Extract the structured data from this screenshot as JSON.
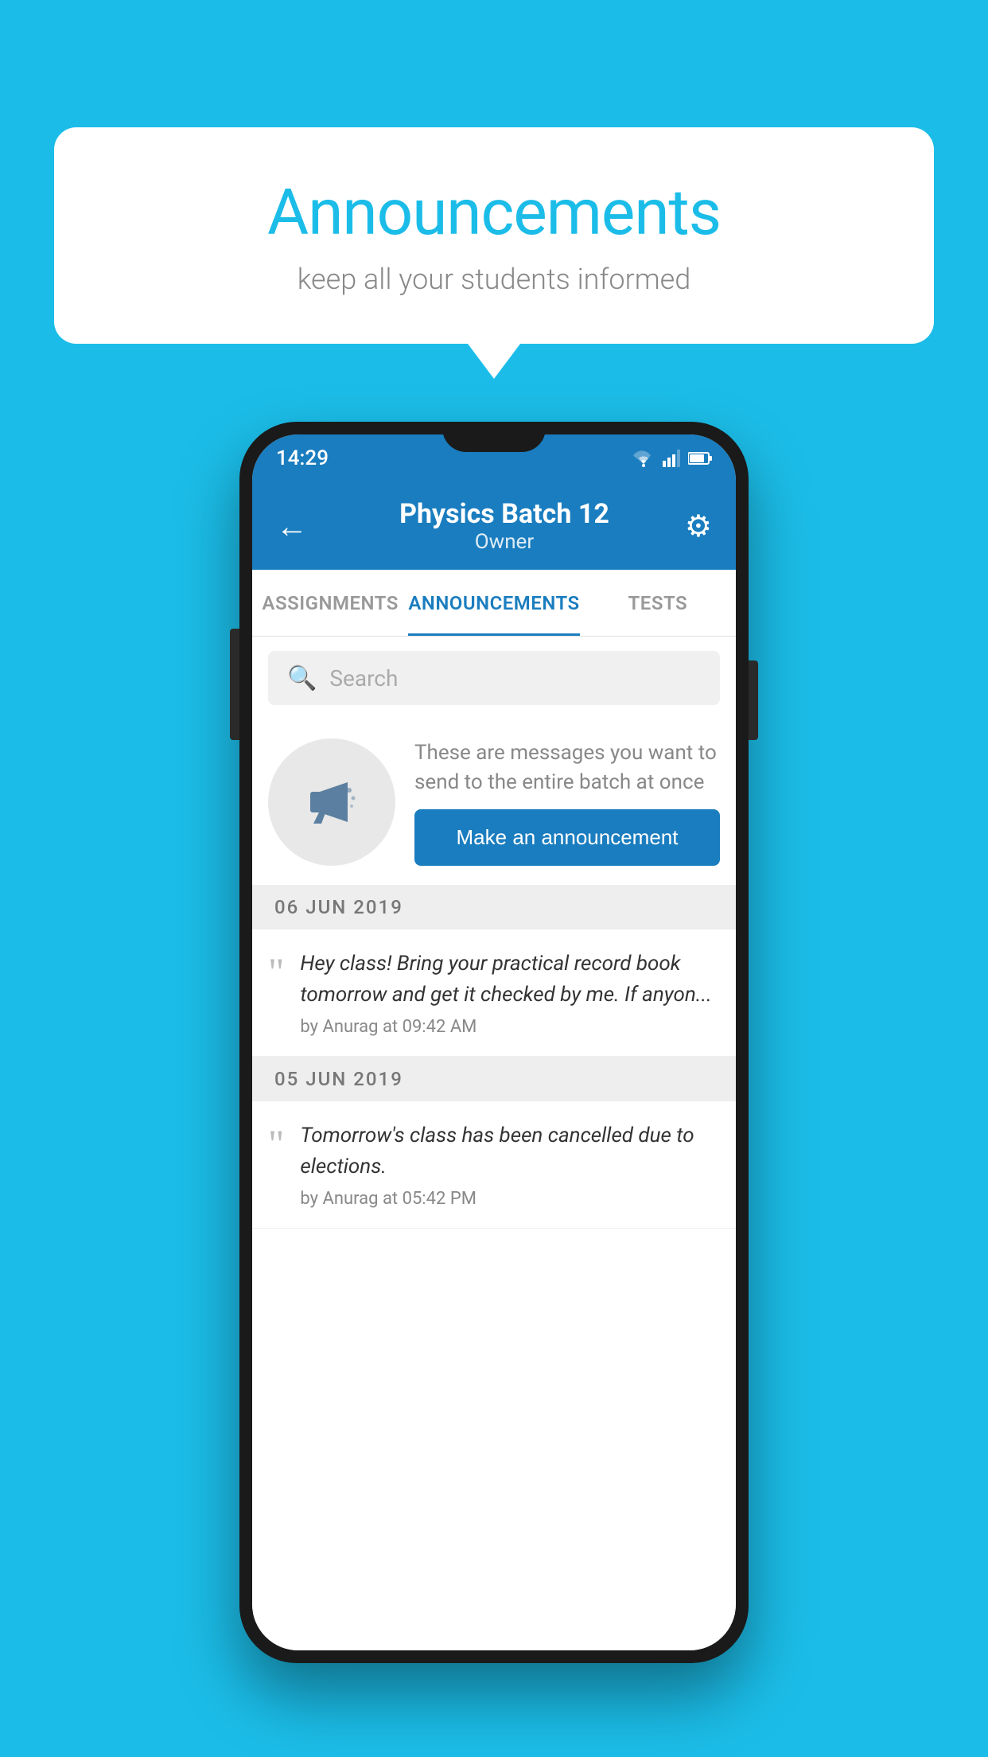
{
  "background_color": "#1BBDE8",
  "speech_bubble": {
    "title": "Announcements",
    "subtitle": "keep all your students informed"
  },
  "phone": {
    "status_bar": {
      "time": "14:29"
    },
    "app_bar": {
      "title": "Physics Batch 12",
      "subtitle": "Owner",
      "back_icon": "←",
      "gear_icon": "⚙"
    },
    "tabs": [
      {
        "label": "ASSIGNMENTS",
        "active": false
      },
      {
        "label": "ANNOUNCEMENTS",
        "active": true
      },
      {
        "label": "TESTS",
        "active": false
      }
    ],
    "search": {
      "placeholder": "Search"
    },
    "promo": {
      "description": "These are messages you want to send to the entire batch at once",
      "button_label": "Make an announcement"
    },
    "announcements": [
      {
        "date": "06  JUN  2019",
        "text": "Hey class! Bring your practical record book tomorrow and get it checked by me. If anyon...",
        "meta": "by Anurag at 09:42 AM"
      },
      {
        "date": "05  JUN  2019",
        "text": "Tomorrow's class has been cancelled due to elections.",
        "meta": "by Anurag at 05:42 PM"
      }
    ]
  }
}
